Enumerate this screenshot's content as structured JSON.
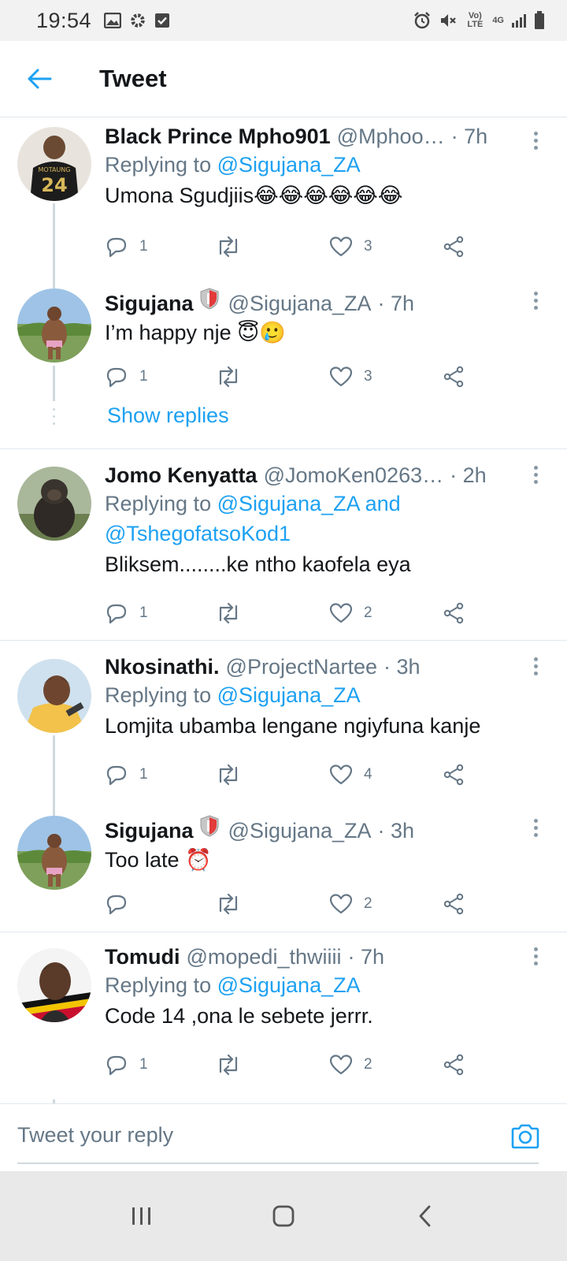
{
  "status_bar": {
    "time": "19:54",
    "network": "4G",
    "volte": "Vo) LTE"
  },
  "header": {
    "title": "Tweet",
    "back_icon": "arrow-left-icon"
  },
  "tweets": [
    {
      "name": "Black Prince Mpho901",
      "handle": "@Mphoo…",
      "time": "· 7h",
      "replying_prefix": "Replying to ",
      "replying_to": "@Sigujana_ZA",
      "text": "Umona Sgudjiis",
      "emoji": "😂😂😂😂😂😂",
      "avatar_jersey": "24",
      "avatar_caption": "MOTAUNG",
      "replies": "1",
      "retweets": "",
      "likes": "3"
    },
    {
      "name": "Sigujana",
      "handle": "@Sigujana_ZA",
      "time": "· 7h",
      "text": "I’m happy nje ",
      "emoji": "😇🥲",
      "replies": "1",
      "retweets": "",
      "likes": "3",
      "show_replies": "Show replies"
    },
    {
      "name": "Jomo Kenyatta",
      "handle": "@JomoKen0263…",
      "time": "· 2h",
      "replying_prefix": "Replying to ",
      "replying_to": "@Sigujana_ZA and",
      "replying_to_2": "@TshegofatsoKod1",
      "text": "Bliksem........ke ntho kaofela eya",
      "replies": "1",
      "retweets": "",
      "likes": "2"
    },
    {
      "name": "Nkosinathi.",
      "handle": "@ProjectNartee",
      "time": "· 3h",
      "replying_prefix": "Replying to ",
      "replying_to": "@Sigujana_ZA",
      "text": "Lomjita ubamba lengane ngiyfuna kanje",
      "replies": "1",
      "retweets": "",
      "likes": "4"
    },
    {
      "name": "Sigujana",
      "handle": "@Sigujana_ZA",
      "time": "· 3h",
      "text": "Too late ",
      "emoji": "⏰",
      "replies": "",
      "retweets": "",
      "likes": "2"
    },
    {
      "name": "Tomudi",
      "handle": "@mopedi_thwiiii",
      "time": "· 7h",
      "replying_prefix": "Replying to ",
      "replying_to": "@Sigujana_ZA",
      "text": "Code 14 ,ona le sebete jerrr.",
      "replies": "1",
      "retweets": "",
      "likes": "2"
    }
  ],
  "reply_bar": {
    "placeholder": "Tweet your reply",
    "camera_icon": "camera-icon"
  },
  "colors": {
    "accent": "#1da1f2",
    "secondary_text": "#657786",
    "primary_text": "#14171a",
    "divider": "#e1e8ed"
  }
}
